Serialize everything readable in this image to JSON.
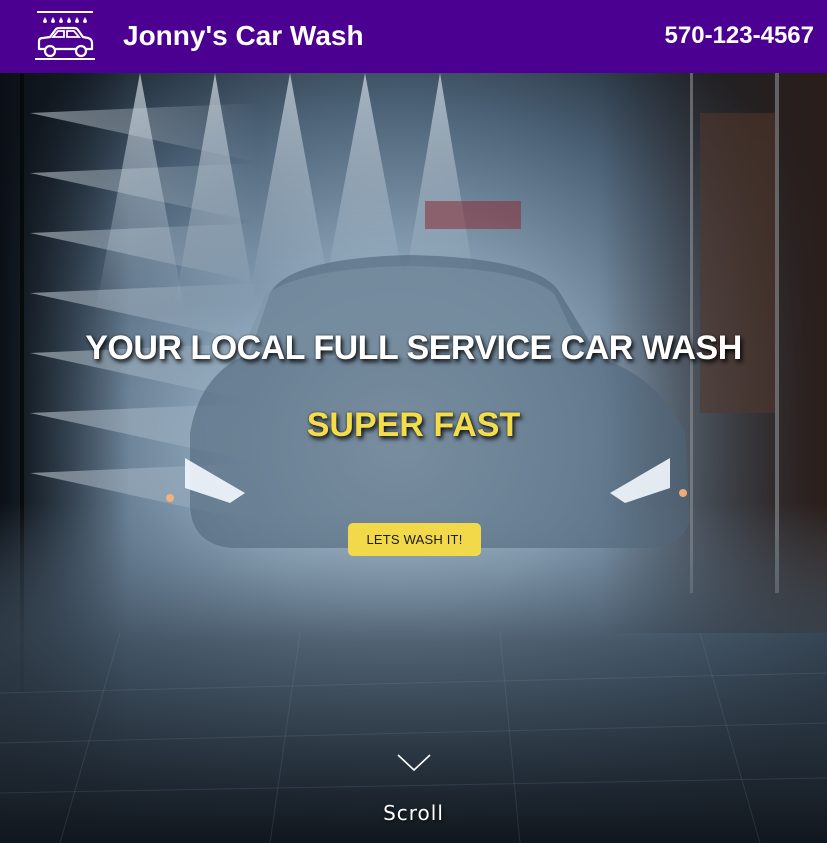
{
  "header": {
    "brand_name": "Jonny's Car Wash",
    "phone": "570-123-4567",
    "logo_icon": "car-wash-icon",
    "background_color": "#4b0092"
  },
  "hero": {
    "title": "YOUR LOCAL FULL SERVICE CAR WASH",
    "subtitle": "SUPER FAST",
    "subtitle_color": "#f3dd4b",
    "cta_label": "LETS WASH IT!",
    "cta_color": "#f1d94a",
    "background_image": "car-in-wash-tunnel-photo",
    "scroll_icon": "chevron-down-icon",
    "scroll_label": "Scroll"
  }
}
